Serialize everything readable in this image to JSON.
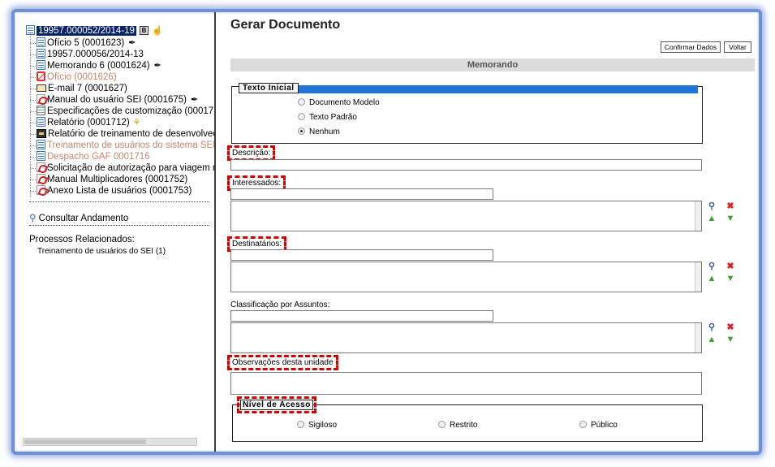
{
  "tree": {
    "root": {
      "label": "19957.000052/2014-19",
      "badge": "B"
    },
    "items": [
      {
        "label": "Ofício 5 (0001623)",
        "icon": "document-icon",
        "extra": "pen-icon",
        "muted": false
      },
      {
        "label": "19957.000056/2014-13",
        "icon": "process-icon",
        "extra": "",
        "muted": false
      },
      {
        "label": "Memorando 6 (0001624)",
        "icon": "document-icon",
        "extra": "pen-icon",
        "muted": false
      },
      {
        "label": "Ofício (0001626)",
        "icon": "cancelled-icon",
        "extra": "",
        "muted": true
      },
      {
        "label": "E-mail 7 (0001627)",
        "icon": "email-icon",
        "extra": "",
        "muted": false
      },
      {
        "label": "Manual do usuário SEI (0001675)",
        "icon": "pdf-icon",
        "extra": "pen-icon",
        "muted": false
      },
      {
        "label": "Especificações de customização (000171",
        "icon": "spreadsheet-icon",
        "extra": "",
        "muted": false
      },
      {
        "label": "Relatório (0001712)",
        "icon": "document-icon",
        "extra": "key-icon",
        "muted": false
      },
      {
        "label": "Relatório de treinamento de desenvolvec",
        "icon": "video-icon",
        "extra": "",
        "muted": false
      },
      {
        "label": "Treinamento de usuários do sistema SEI",
        "icon": "document-icon",
        "extra": "",
        "muted": true
      },
      {
        "label": "Despacho GAF 0001716",
        "icon": "document-icon",
        "extra": "",
        "muted": true
      },
      {
        "label": "Solicitação de autorização para viagem n",
        "icon": "pdf-icon",
        "extra": "",
        "muted": false
      },
      {
        "label": "Manual Multiplicadores (0001752)",
        "icon": "pdf-icon",
        "extra": "",
        "muted": false
      },
      {
        "label": "Anexo Lista de usuários (0001753)",
        "icon": "pdf-icon",
        "extra": "",
        "muted": false
      }
    ]
  },
  "left": {
    "consultar": "Consultar Andamento",
    "processos_title": "Processos Relacionados:",
    "processos_link": "Treinamento de usuários do SEI (1)"
  },
  "form": {
    "title": "Gerar Documento",
    "confirmar": "Confirmar Dados",
    "voltar": "Voltar",
    "section": "Memorando",
    "texto_inicial": {
      "legend": "Texto Inicial",
      "options": [
        "Documento Modelo",
        "Texto Padrão",
        "Nenhum"
      ],
      "selected": "Nenhum"
    },
    "descricao": "Descrição:",
    "interessados": "Interessados:",
    "destinatarios": "Destinatários:",
    "classificacao": "Classificação por Assuntos:",
    "observacoes": "Observações desta unidade",
    "nivel_acesso": {
      "legend": "Nível de Acesso",
      "options": [
        "Sigiloso",
        "Restrito",
        "Público"
      ]
    }
  },
  "colors": {
    "frame": "#6f8fd9",
    "highlight": "#d30000",
    "legend_bar": "#1f75d6"
  }
}
